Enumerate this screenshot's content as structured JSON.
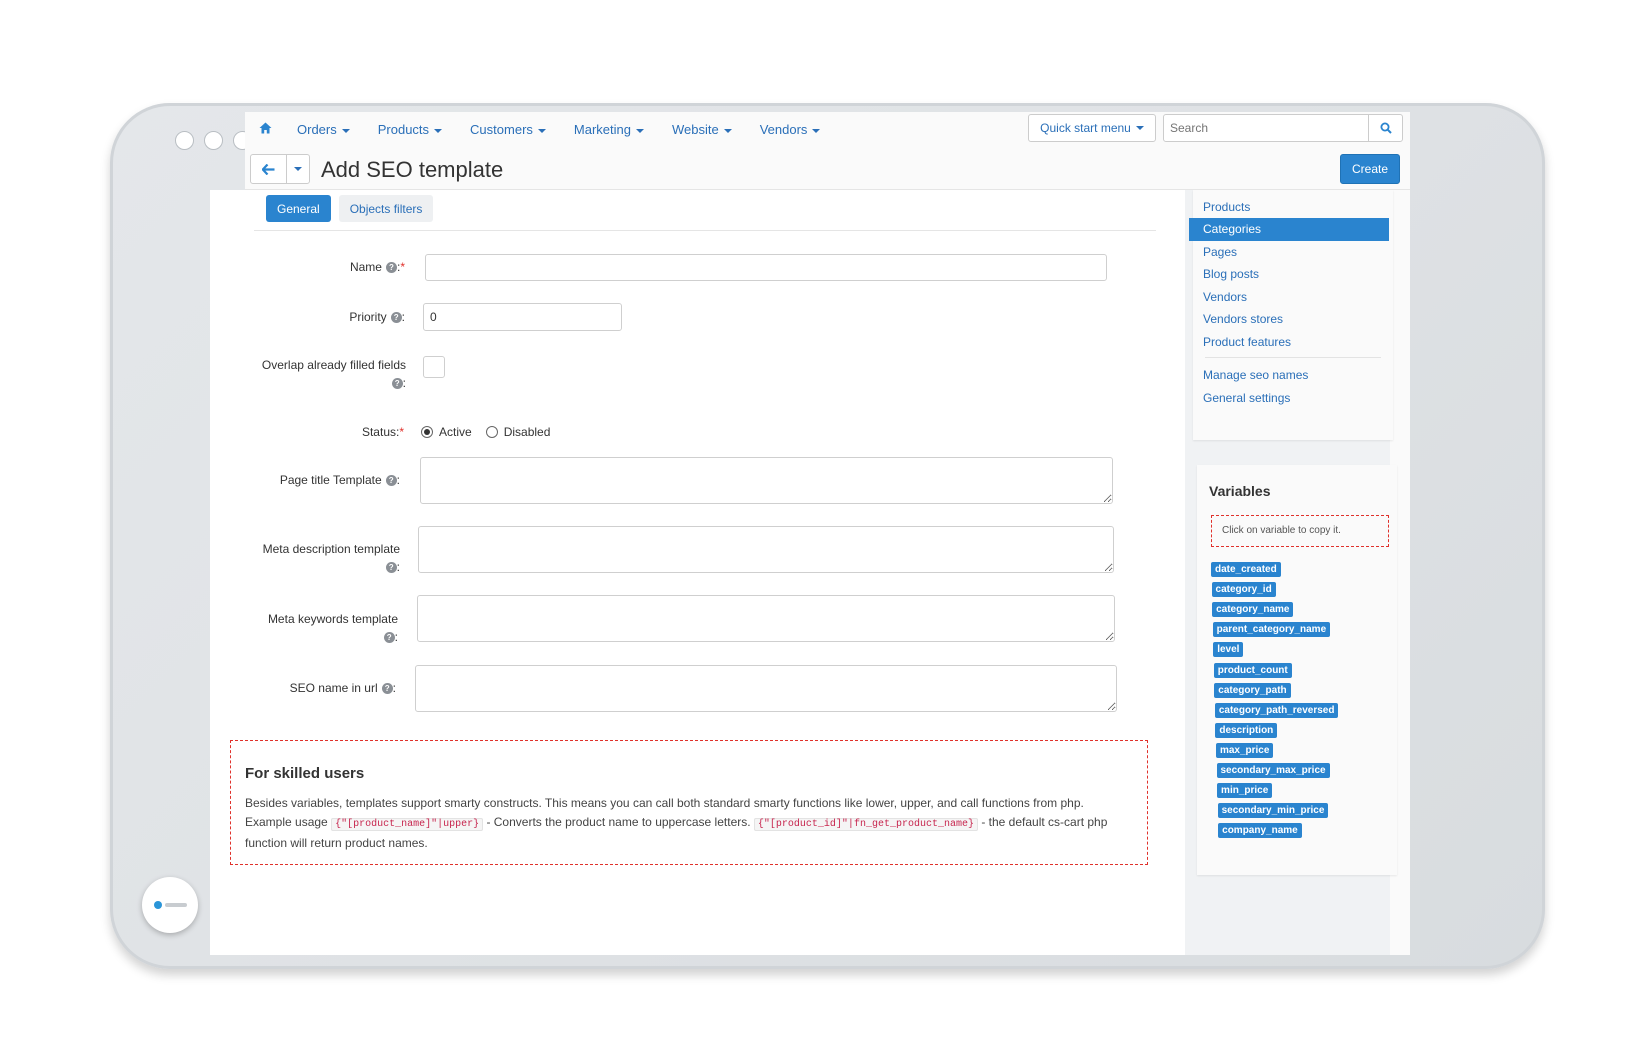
{
  "nav": {
    "items": [
      "Orders",
      "Products",
      "Customers",
      "Marketing",
      "Website",
      "Vendors"
    ],
    "quick_start": "Quick start menu",
    "search_placeholder": "Search"
  },
  "title": "Add SEO template",
  "create_label": "Create",
  "tabs": [
    "General",
    "Objects filters"
  ],
  "form": {
    "name_label": "Name",
    "priority_label": "Priority",
    "priority_value": "0",
    "overlap_label": "Overlap already filled fields",
    "status_label": "Status:",
    "status_active": "Active",
    "status_disabled": "Disabled",
    "page_title_label": "Page title Template",
    "meta_desc_label": "Meta description template",
    "meta_keywords_label": "Meta keywords template",
    "seo_name_label": "SEO name in url"
  },
  "skilled": {
    "heading": "For skilled users",
    "line1": "Besides variables, templates support smarty constructs. This means you can call both standard smarty functions like lower, upper, and call functions from php.",
    "prefix": "Example usage",
    "code1": "{\"[product_name]\"|upper}",
    "mid": "- Converts the product name to uppercase letters.",
    "code2": "{\"[product_id]\"|fn_get_product_name}",
    "suffix": "- the default cs-cart php function will return product names."
  },
  "sidebar": {
    "items": [
      "Products",
      "Categories",
      "Pages",
      "Blog posts",
      "Vendors",
      "Vendors stores",
      "Product features"
    ],
    "active": "Categories",
    "links": [
      "Manage seo names",
      "General settings"
    ]
  },
  "variables": {
    "title": "Variables",
    "hint": "Click on variable to copy it.",
    "list": [
      "date_created",
      "category_id",
      "category_name",
      "parent_category_name",
      "level",
      "product_count",
      "category_path",
      "category_path_reversed",
      "description",
      "max_price",
      "secondary_max_price",
      "min_price",
      "secondary_min_price",
      "company_name"
    ]
  },
  "colors": {
    "accent": "#2a84cf",
    "link": "#2a6fb8",
    "required": "#e0312b"
  }
}
